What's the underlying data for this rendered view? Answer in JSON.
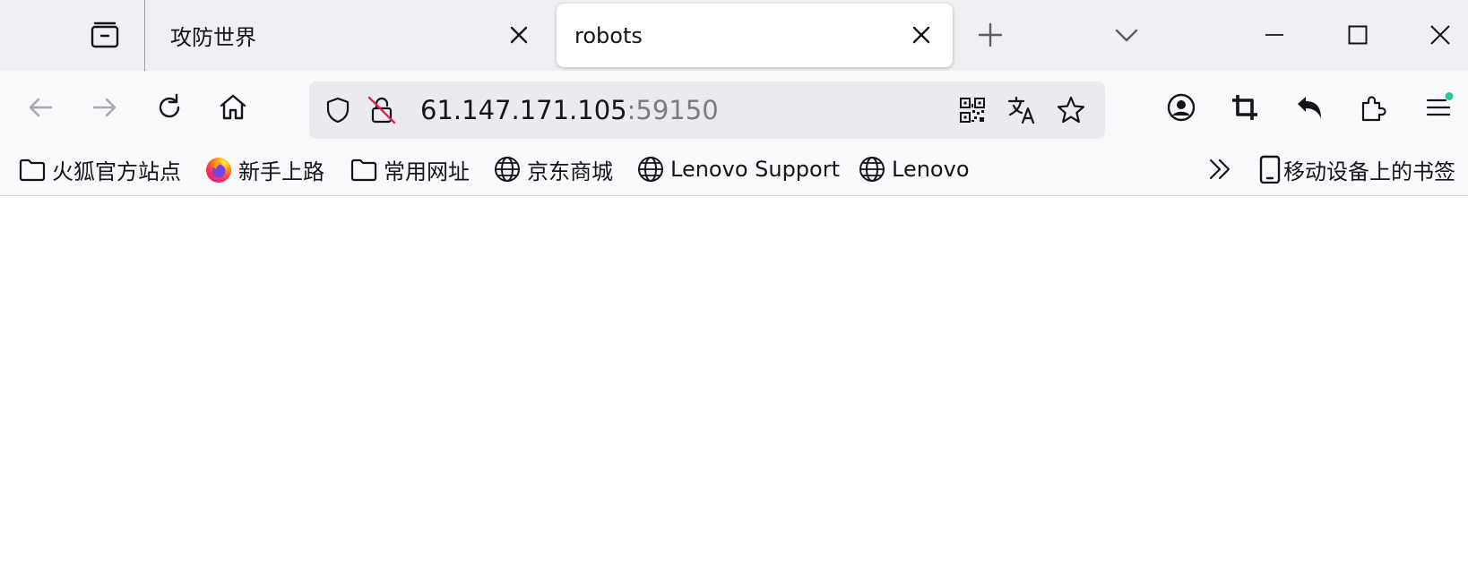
{
  "tabs": [
    {
      "title": "攻防世界",
      "active": false
    },
    {
      "title": "robots",
      "active": true
    }
  ],
  "urlbar": {
    "host": "61.147.171.105",
    "port": ":59150"
  },
  "bookmarks": [
    {
      "label": "火狐官方站点",
      "icon": "folder-icon"
    },
    {
      "label": "新手上路",
      "icon": "firefox-icon"
    },
    {
      "label": "常用网址",
      "icon": "folder-icon"
    },
    {
      "label": "京东商城",
      "icon": "globe-icon"
    },
    {
      "label": "Lenovo Support",
      "icon": "globe-icon"
    },
    {
      "label": "Lenovo",
      "icon": "globe-icon"
    }
  ],
  "mobile_bookmarks": {
    "label": "移动设备上的书签",
    "icon": "mobile-device-icon"
  },
  "colors": {
    "tabstrip_bg": "#f0f0f4",
    "toolbar_bg": "#f9f9fb",
    "urlbar_bg": "#ebebef",
    "badge": "#2ac3a2",
    "insecure_slash": "#e22850"
  }
}
